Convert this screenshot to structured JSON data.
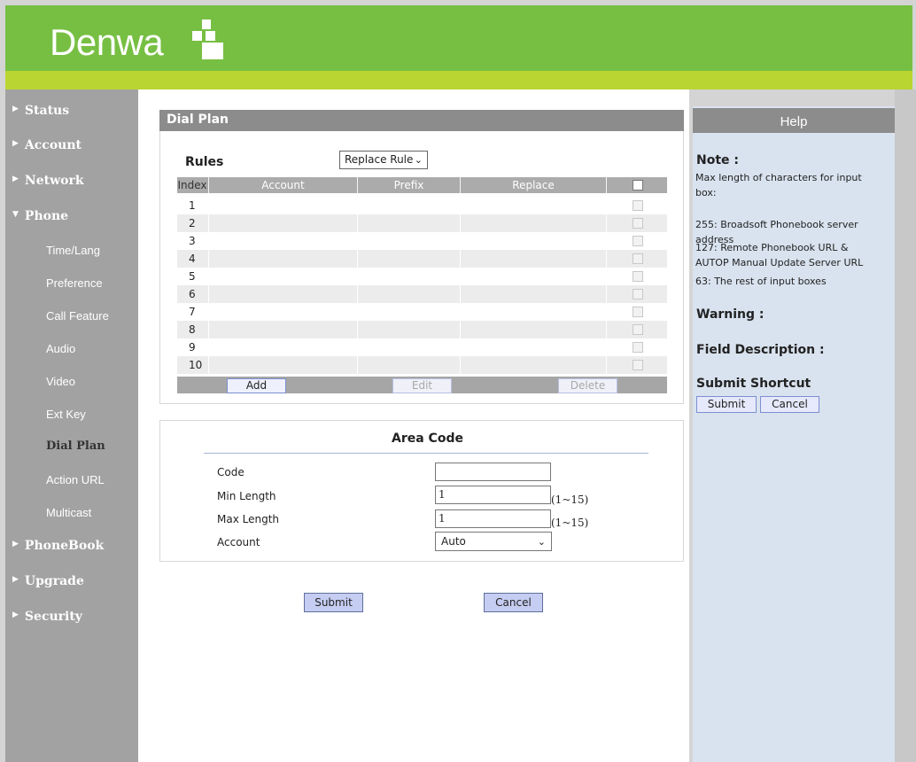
{
  "brand": {
    "name": "Denwa"
  },
  "sidebar": {
    "items": [
      {
        "label": "Status",
        "expanded": false
      },
      {
        "label": "Account",
        "expanded": false
      },
      {
        "label": "Network",
        "expanded": false
      },
      {
        "label": "Phone",
        "expanded": true
      },
      {
        "label": "PhoneBook",
        "expanded": false
      },
      {
        "label": "Upgrade",
        "expanded": false
      },
      {
        "label": "Security",
        "expanded": false
      }
    ],
    "phone_sub": [
      "Time/Lang",
      "Preference",
      "Call Feature",
      "Audio",
      "Video",
      "Ext Key",
      "Dial Plan",
      "Action URL",
      "Multicast"
    ],
    "active": "Dial Plan"
  },
  "dialplan": {
    "title": "Dial Plan",
    "rules_label": "Rules",
    "rule_type": "Replace Rule",
    "columns": [
      "Index",
      "Account",
      "Prefix",
      "Replace"
    ],
    "rows": [
      "1",
      "2",
      "3",
      "4",
      "5",
      "6",
      "7",
      "8",
      "9",
      "10"
    ],
    "add_label": "Add",
    "edit_label": "Edit",
    "delete_label": "Delete"
  },
  "area_code": {
    "title": "Area Code",
    "code_label": "Code",
    "code_value": "",
    "min_label": "Min Length",
    "min_value": "1",
    "min_hint": "(1~15)",
    "max_label": "Max Length",
    "max_value": "1",
    "max_hint": "(1~15)",
    "account_label": "Account",
    "account_value": "Auto"
  },
  "actions": {
    "submit": "Submit",
    "cancel": "Cancel"
  },
  "help": {
    "title": "Help",
    "note_heading": "Note :",
    "note_lines": [
      "Max length of characters for input box:",
      "255: Broadsoft Phonebook server address",
      "127: Remote Phonebook URL & AUTOP Manual Update Server URL",
      "63: The rest of input boxes"
    ],
    "warning_heading": "Warning :",
    "field_heading": "Field Description :",
    "shortcut_heading": "Submit Shortcut",
    "submit": "Submit",
    "cancel": "Cancel"
  },
  "colors": {
    "header_green": "#77bf43",
    "stripe_lime": "#b9d532",
    "sidebar_gray": "#a2a2a2",
    "help_blue": "#d9e3ef",
    "button_blue": "#c6cdf2"
  }
}
